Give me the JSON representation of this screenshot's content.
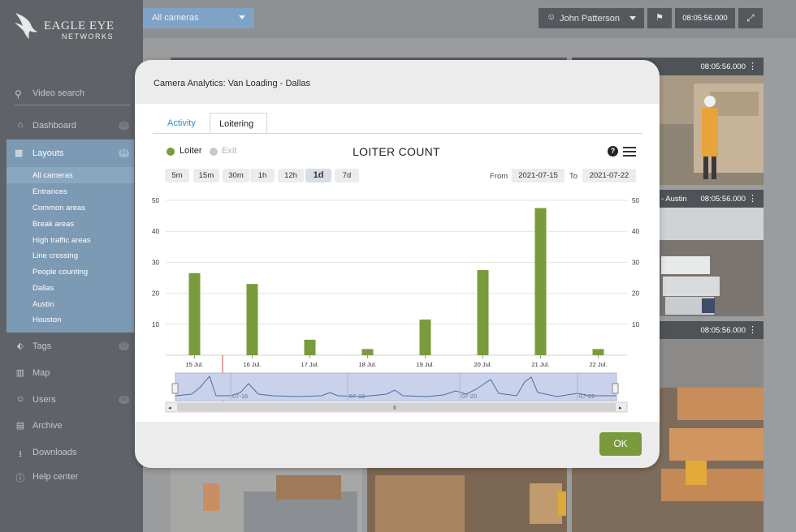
{
  "brand": {
    "line1": "EAGLE EYE",
    "line2": "NETWORKS"
  },
  "sidebar": {
    "search_label": "Video search",
    "nav_top": [
      {
        "label": "Dashboard",
        "count": "55"
      }
    ],
    "layouts": {
      "label": "Layouts",
      "count": "24",
      "items": [
        "All cameras",
        "Entrances",
        "Common areas",
        "Break areas",
        "High traffic areas",
        "Line crossing",
        "People counting",
        "Dallas",
        "Austin",
        "Houston"
      ]
    },
    "nav_bottom": [
      {
        "label": "Tags",
        "count": "17"
      },
      {
        "label": "Map",
        "count": ""
      },
      {
        "label": "Users",
        "count": "36"
      },
      {
        "label": "Archive",
        "count": ""
      },
      {
        "label": "Downloads",
        "count": ""
      },
      {
        "label": "Help center",
        "count": ""
      }
    ]
  },
  "topbar": {
    "camera_select": "All cameras",
    "user_name": "John Patterson",
    "time": "08:05:56.000"
  },
  "tiles": [
    {
      "name": "",
      "time": "08:05:56.000"
    },
    {
      "name": "- Austin",
      "time": "08:05:56.000"
    },
    {
      "name": "",
      "time": "08:05:56.000"
    }
  ],
  "modal": {
    "title": "Camera Analytics: Van Loading - Dallas",
    "tabs": [
      "Activity",
      "Loitering"
    ],
    "active_tab": "Loitering",
    "legend": [
      {
        "label": "Loiter",
        "color": "#7a9b3b",
        "active": true
      },
      {
        "label": "Exit",
        "color": "#c9c9c9",
        "active": false
      }
    ],
    "chart_title": "LOITER COUNT",
    "ranges": [
      "5m",
      "15m",
      "30m",
      "1h",
      "12h",
      "1d",
      "7d"
    ],
    "selected_range": "1d",
    "from_label": "From",
    "from_date": "2021-07-15",
    "to_label": "To",
    "to_date": "2021-07-22",
    "ok_label": "OK"
  },
  "chart_data": {
    "type": "bar",
    "title": "LOITER COUNT",
    "categories": [
      "15 Jul.",
      "16 Jul.",
      "17 Jul.",
      "18 Jul.",
      "19 Jul.",
      "20 Jul.",
      "21 Jul.",
      "22 Jul."
    ],
    "series": [
      {
        "name": "Loiter",
        "values": [
          26.5,
          23,
          5,
          2,
          11.5,
          27.5,
          47.5,
          2
        ]
      }
    ],
    "ylim": [
      0,
      50
    ],
    "yticks": [
      10,
      20,
      30,
      40,
      50
    ],
    "navigator_labels": [
      "07-16",
      "07-18",
      "07-20",
      "07-22"
    ],
    "bar_color": "#7a9b3b",
    "grid": true
  }
}
